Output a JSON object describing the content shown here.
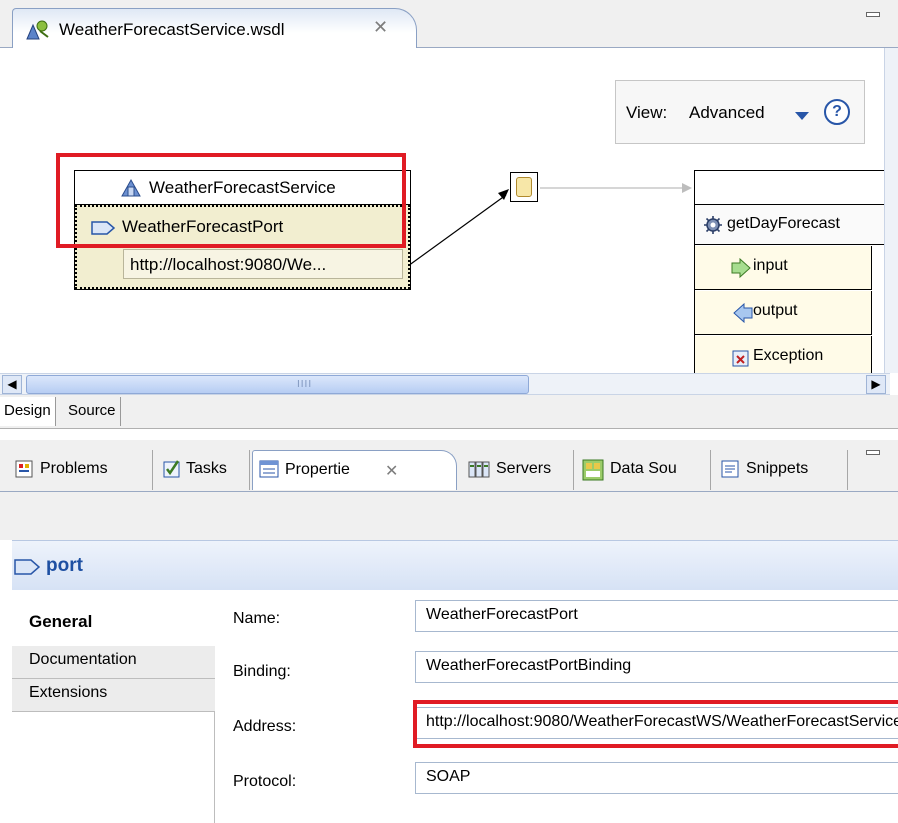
{
  "editor": {
    "tab_title": "WeatherForecastService.wsdl",
    "close_glyph": "✕"
  },
  "canvas": {
    "view_label": "View:",
    "view_value": "Advanced",
    "help_glyph": "?",
    "service": {
      "name": "WeatherForecastService",
      "port_name": "WeatherForecastPort",
      "port_address": "http://localhost:9080/We..."
    },
    "operation": "getDayForecast",
    "messages": [
      "input",
      "output",
      "Exception"
    ],
    "scroll_grip": "IIII"
  },
  "editor_tabs": [
    "Design",
    "Source"
  ],
  "view_tabs": {
    "problems": "Problems",
    "tasks": "Tasks",
    "properties": "Propertie",
    "servers": "Servers",
    "data_source": "Data Sou",
    "snippets": "Snippets",
    "close_glyph": "✕"
  },
  "properties": {
    "header": "port",
    "tabs": [
      "General",
      "Documentation",
      "Extensions"
    ],
    "fields": [
      {
        "label": "Name:",
        "value": "WeatherForecastPort"
      },
      {
        "label": "Binding:",
        "value": "WeatherForecastPortBinding"
      },
      {
        "label": "Address:",
        "value": "http://localhost:9080/WeatherForecastWS/WeatherForecastService"
      },
      {
        "label": "Protocol:",
        "value": "SOAP"
      }
    ]
  },
  "colors": {
    "highlight": "#e01b24",
    "header_text": "#1e50a2",
    "port_fill": "#f2eed0"
  }
}
